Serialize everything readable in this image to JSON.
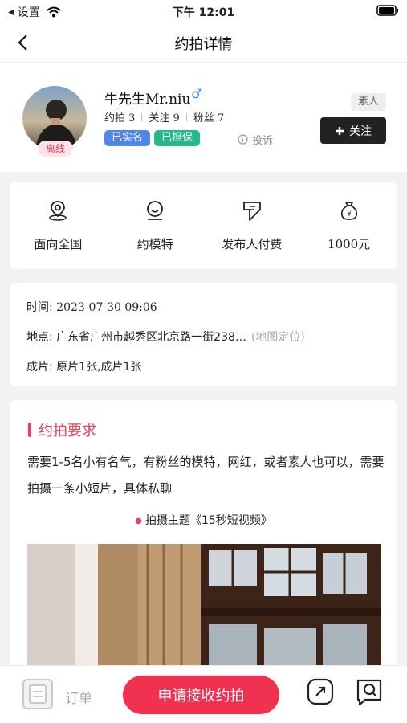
{
  "status_bar": {
    "back_label": "设置",
    "time": "下午 12:01"
  },
  "nav": {
    "title": "约拍详情"
  },
  "profile": {
    "name": "牛先生Mr.niu",
    "gender_symbol": "♂",
    "status": "离线",
    "stats": {
      "shoots": "约拍 3",
      "following": "关注 9",
      "followers": "粉丝 7"
    },
    "badges": [
      "已实名",
      "已担保"
    ],
    "report_label": "投诉",
    "tag": "素人",
    "follow_label": "关注"
  },
  "features": [
    {
      "label": "面向全国",
      "icon": "location-icon"
    },
    {
      "label": "约模特",
      "icon": "model-icon"
    },
    {
      "label": "发布人付费",
      "icon": "payment-icon"
    },
    {
      "label": "1000元",
      "icon": "money-bag-icon"
    }
  ],
  "info": {
    "time_label": "时间: ",
    "time_value": "2023-07-30 09:06",
    "address_label": "地点: 广东省广州市越秀区北京路一街238…",
    "map_link": "(地图定位)",
    "output_label": "成片: 原片1张,成片1张"
  },
  "requirement": {
    "title": "约拍要求",
    "description": "需要1-5名小有名气，有粉丝的模特，网红，或者素人也可以，需要拍摄一条小短片，具体私聊",
    "theme": "拍摄主题《15秒短视频》"
  },
  "bottom_bar": {
    "order_label": "订单",
    "apply_label": "申请接收约拍"
  },
  "colors": {
    "accent": "#f0314f",
    "verified": "#4f86e8",
    "guaranteed": "#23b98a",
    "follow_bg": "#222222"
  }
}
